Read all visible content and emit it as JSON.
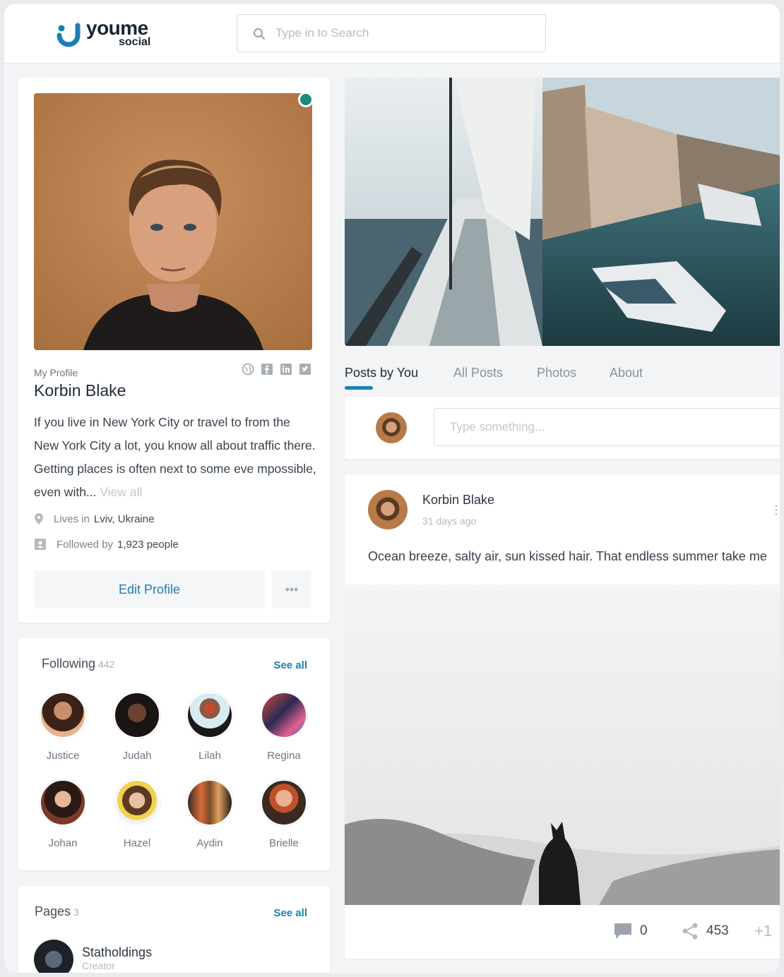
{
  "brand": {
    "word": "youme",
    "sub": "social",
    "accent": "#1a7fb5"
  },
  "search": {
    "placeholder": "Type in to Search",
    "icon": "search-icon"
  },
  "profile": {
    "kicker": "My Profile",
    "name": "Korbin Blake",
    "bio": "If you live in New York City or travel to from the New York City a lot, you know all about  traffic there. Getting places is often next to some eve mpossible, even with...",
    "view_all": "View all",
    "lives_label": "Lives in",
    "lives_value": "Lviv, Ukraine",
    "followed_label": "Followed by",
    "followed_value": "1,923 people",
    "edit_label": "Edit Profile",
    "more_label": "•••",
    "online_color": "#1b8a7a",
    "social_icons": [
      "globe-icon",
      "facebook-icon",
      "linkedin-icon",
      "twitter-icon"
    ]
  },
  "following": {
    "title": "Following",
    "count": "442",
    "see_all": "See all",
    "people": [
      "Justice",
      "Judah",
      "Lilah",
      "Regina",
      "Johan",
      "Hazel",
      "Aydin",
      "Brielle"
    ]
  },
  "pages": {
    "title": "Pages",
    "count": "3",
    "see_all": "See all",
    "items": [
      {
        "name": "Statholdings",
        "sub": "Creator"
      }
    ]
  },
  "tabs": [
    "Posts by You",
    "All Posts",
    "Photos",
    "About"
  ],
  "composer": {
    "placeholder": "Type something..."
  },
  "post": {
    "author": "Korbin Blake",
    "time": "31 days ago",
    "text": "Ocean breeze, salty air, sun kissed hair. That endless summer take me",
    "comments": "0",
    "shares": "453",
    "plus": "+1"
  }
}
